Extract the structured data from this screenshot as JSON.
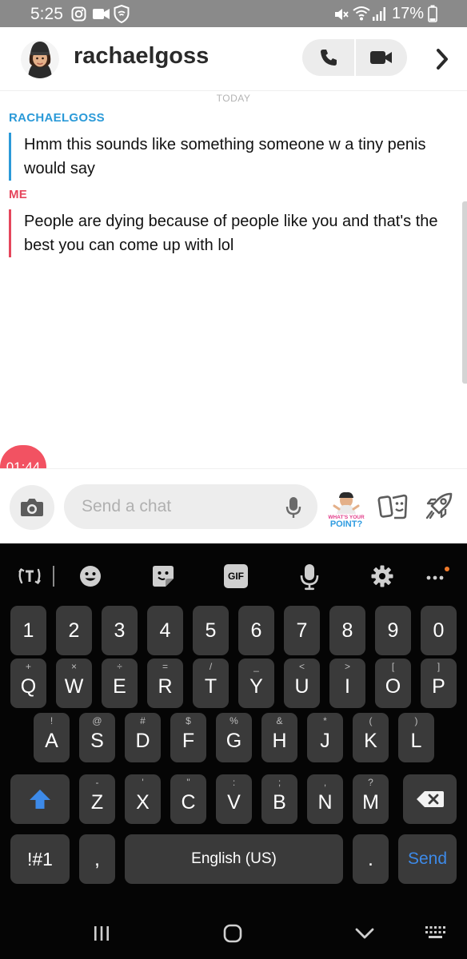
{
  "status_bar": {
    "time": "5:25",
    "battery_percent": "17%",
    "left_icons": [
      "instagram-icon",
      "video-record-icon",
      "vpn-shield-icon"
    ],
    "right_icons": [
      "mute-icon",
      "wifi-icon",
      "signal-icon",
      "battery-icon"
    ]
  },
  "header": {
    "username": "rachaelgoss",
    "icons": [
      "avatar",
      "phone-icon",
      "video-camera-icon",
      "chevron-right-icon"
    ]
  },
  "chat": {
    "date_divider": "TODAY",
    "messages": [
      {
        "sender": "RACHAELGOSS",
        "text": "Hmm this sounds like something someone w a tiny penis would say",
        "color": "#2b9ad8"
      },
      {
        "sender": "ME",
        "text": "People are dying because of people like you and that's the best you can come up with lol",
        "color": "#e5465c"
      }
    ]
  },
  "timer": {
    "text": "01:44",
    "color": "#f25262"
  },
  "input": {
    "placeholder": "Send a chat",
    "sticker_text": "WHAT'S YOUR POINT?",
    "icons": [
      "camera-icon",
      "microphone-icon",
      "bitmoji-sticker",
      "stickers-icon",
      "rocket-icon"
    ]
  },
  "keyboard": {
    "toolbar_icons": [
      "text-transform-icon",
      "emoji-icon",
      "sticker-icon",
      "gif-icon",
      "voice-input-icon",
      "settings-icon",
      "more-icon"
    ],
    "gif_label": "GIF",
    "number_row": [
      "1",
      "2",
      "3",
      "4",
      "5",
      "6",
      "7",
      "8",
      "9",
      "0"
    ],
    "rows": [
      [
        [
          "Q",
          "+"
        ],
        [
          "W",
          "×"
        ],
        [
          "E",
          "÷"
        ],
        [
          "R",
          "="
        ],
        [
          "T",
          "/"
        ],
        [
          "Y",
          "_"
        ],
        [
          "U",
          "<"
        ],
        [
          "I",
          ">"
        ],
        [
          "O",
          "["
        ],
        [
          "P",
          "]"
        ]
      ],
      [
        [
          "A",
          "!"
        ],
        [
          "S",
          "@"
        ],
        [
          "D",
          "#"
        ],
        [
          "F",
          "$"
        ],
        [
          "G",
          "%"
        ],
        [
          "H",
          "&"
        ],
        [
          "J",
          "*"
        ],
        [
          "K",
          "("
        ],
        [
          "L",
          ")"
        ]
      ],
      [
        [
          "Z",
          "-"
        ],
        [
          "X",
          "'"
        ],
        [
          "C",
          "\""
        ],
        [
          "V",
          ":"
        ],
        [
          "B",
          ";"
        ],
        [
          "N",
          ","
        ],
        [
          "M",
          "?"
        ]
      ]
    ],
    "symbols_label": "!#1",
    "comma_label": ",",
    "space_label": "English (US)",
    "period_label": ".",
    "send_label": "Send",
    "accent_color": "#3d8ae8"
  },
  "navbar": {
    "icons": [
      "recents-icon",
      "home-icon",
      "back-icon",
      "keyboard-switch-icon"
    ]
  }
}
